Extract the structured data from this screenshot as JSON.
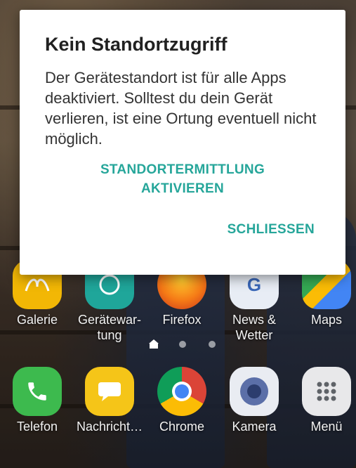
{
  "dialog": {
    "title": "Kein Standortzugriff",
    "body": "Der Gerätestandort ist für alle Apps deaktiviert. Solltest du dein Gerät verlieren, ist eine Ortung eventuell nicht möglich.",
    "activate_line1": "STANDORTERMITTLUNG",
    "activate_line2": "AKTIVIEREN",
    "close_label": "SCHLIESSEN",
    "accent_color": "#26a69a"
  },
  "home_apps": [
    {
      "label": "Galerie",
      "icon": "gallery-icon"
    },
    {
      "label": "Gerätewar-",
      "label2": "tung",
      "icon": "device-maintenance-icon"
    },
    {
      "label": "Firefox",
      "icon": "firefox-icon"
    },
    {
      "label": "News &",
      "label2": "Wetter",
      "icon": "news-weather-icon"
    },
    {
      "label": "Maps",
      "icon": "maps-icon"
    }
  ],
  "dock_apps": [
    {
      "label": "Telefon",
      "icon": "phone-icon"
    },
    {
      "label": "Nachricht…",
      "icon": "messages-icon"
    },
    {
      "label": "Chrome",
      "icon": "chrome-icon"
    },
    {
      "label": "Kamera",
      "icon": "camera-icon"
    },
    {
      "label": "Menü",
      "icon": "apps-menu-icon"
    }
  ],
  "page_indicator": {
    "pages": 3,
    "current": "home"
  }
}
